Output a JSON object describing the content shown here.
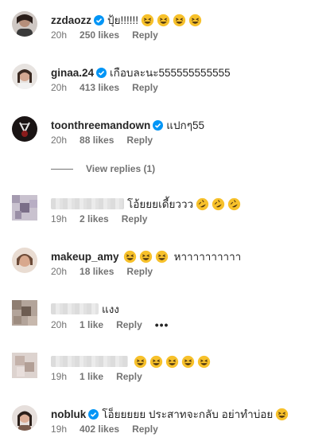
{
  "comments": [
    {
      "username": "zzdaozz",
      "verified": true,
      "text": "ปุ้ย!!!!!!",
      "emoji_count": 4,
      "time": "20h",
      "likes": "250 likes",
      "reply": "Reply"
    },
    {
      "username": "ginaa.24",
      "verified": true,
      "text": "เกือบละนะ555555555555",
      "emoji_count": 0,
      "time": "20h",
      "likes": "413 likes",
      "reply": "Reply"
    },
    {
      "username": "toonthreemandown",
      "verified": true,
      "text": "แปกๆ55",
      "emoji_count": 0,
      "time": "20h",
      "likes": "88 likes",
      "reply": "Reply"
    },
    {
      "username": "",
      "verified": false,
      "text": "โอ้ยยยเดี้ยววว",
      "emoji_count": 3,
      "time": "19h",
      "likes": "2 likes",
      "reply": "Reply"
    },
    {
      "username": "makeup_amy",
      "verified": false,
      "text": "หาาาาาาาาาา",
      "emoji_count": 3,
      "time": "20h",
      "likes": "18 likes",
      "reply": "Reply"
    },
    {
      "username": "",
      "verified": false,
      "text": "แงง",
      "emoji_count": 0,
      "time": "20h",
      "likes": "1 like",
      "reply": "Reply"
    },
    {
      "username": "",
      "verified": false,
      "text": "",
      "emoji_count": 5,
      "time": "19h",
      "likes": "1 like",
      "reply": "Reply"
    },
    {
      "username": "nobluk",
      "verified": true,
      "text": "โอ็ยยยยย ประสาทจะกลับ อย่าทำบ่อย",
      "emoji_count": 1,
      "time": "19h",
      "likes": "402 likes",
      "reply": "Reply"
    }
  ],
  "view_replies": "View replies (1)",
  "more_options": "•••",
  "colors": {
    "verified": "#0095f6",
    "meta": "#737373",
    "text": "#262626",
    "emoji": "#f7c12b"
  }
}
